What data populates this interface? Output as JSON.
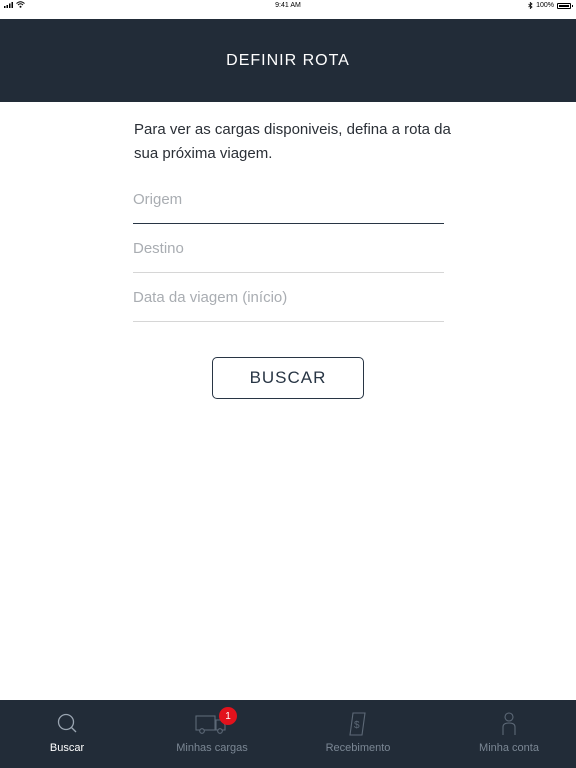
{
  "status_bar": {
    "time": "9:41 AM",
    "battery": "100%"
  },
  "header": {
    "title": "DEFINIR ROTA"
  },
  "intro_text": "Para ver as cargas disponiveis, defina a rota da sua próxima viagem.",
  "form": {
    "origem_placeholder": "Origem",
    "destino_placeholder": "Destino",
    "data_placeholder": "Data da viagem (início)",
    "search_label": "BUSCAR"
  },
  "tabbar": {
    "items": [
      {
        "label": "Buscar",
        "icon": "search-icon",
        "active": true
      },
      {
        "label": "Minhas cargas",
        "icon": "truck-icon",
        "badge": "1"
      },
      {
        "label": "Recebimento",
        "icon": "receipt-icon"
      },
      {
        "label": "Minha conta",
        "icon": "person-icon"
      }
    ]
  },
  "colors": {
    "header_bg": "#222c38",
    "badge": "#e2121c"
  }
}
